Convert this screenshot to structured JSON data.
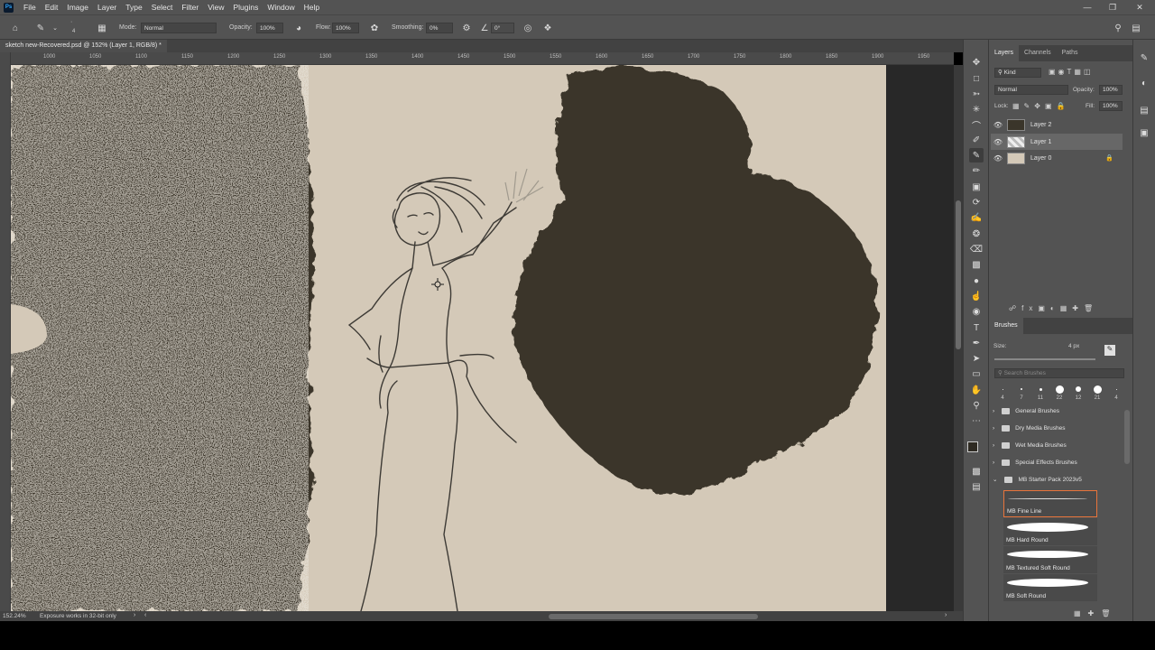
{
  "menubar": {
    "app_icon": "Ps",
    "items": [
      "File",
      "Edit",
      "Image",
      "Layer",
      "Type",
      "Select",
      "Filter",
      "View",
      "Plugins",
      "Window",
      "Help"
    ],
    "window_controls": [
      "minimize-icon",
      "restore-icon",
      "close-icon"
    ]
  },
  "options": {
    "brush_size": "4",
    "mode_label": "Mode:",
    "mode_value": "Normal",
    "opacity_label": "Opacity:",
    "opacity_value": "100%",
    "flow_label": "Flow:",
    "flow_value": "100%",
    "smoothing_label": "Smoothing:",
    "smoothing_value": "0%",
    "angle_value": "0°"
  },
  "document": {
    "tab_title": "sketch new-Recovered.psd @ 152% (Layer 1, RGB/8) *",
    "ruler_ticks": [
      "1000",
      "1050",
      "1100",
      "1150",
      "1200",
      "1250",
      "1300",
      "1350",
      "1400",
      "1450",
      "1500",
      "1550",
      "1600",
      "1650",
      "1700",
      "1750",
      "1800",
      "1850",
      "1900",
      "1950"
    ]
  },
  "status": {
    "zoom": "152.24%",
    "message": "Exposure works in 32-bit only"
  },
  "layers_panel": {
    "tabs": [
      "Layers",
      "Channels",
      "Paths"
    ],
    "filter_label": "Kind",
    "blend_mode": "Normal",
    "opacity_label": "Opacity:",
    "opacity_value": "100%",
    "lock_label": "Lock:",
    "fill_label": "Fill:",
    "fill_value": "100%",
    "layers": [
      {
        "name": "Layer 2",
        "selected": false,
        "locked": false
      },
      {
        "name": "Layer 1",
        "selected": true,
        "locked": false
      },
      {
        "name": "Layer 0",
        "selected": false,
        "locked": true
      }
    ]
  },
  "brushes_panel": {
    "title": "Brushes",
    "size_label": "Size:",
    "size_value": "4 px",
    "search_placeholder": "Search Brushes",
    "recent_sizes": [
      "4",
      "7",
      "11",
      "22",
      "12",
      "21",
      "4"
    ],
    "folders": [
      "General Brushes",
      "Dry Media Brushes",
      "Wet Media Brushes",
      "Special Effects Brushes",
      "MB Starter Pack 2023v5"
    ],
    "brushes": [
      "MB Fine Line",
      "MB Hard Round",
      "MB Textured Soft Round",
      "MB Soft Round"
    ]
  },
  "colors": {
    "canvas": "#d4c9b8",
    "paint": "#3a352a",
    "selection_outline": "#e8743b",
    "accent": "#31a8ff"
  }
}
